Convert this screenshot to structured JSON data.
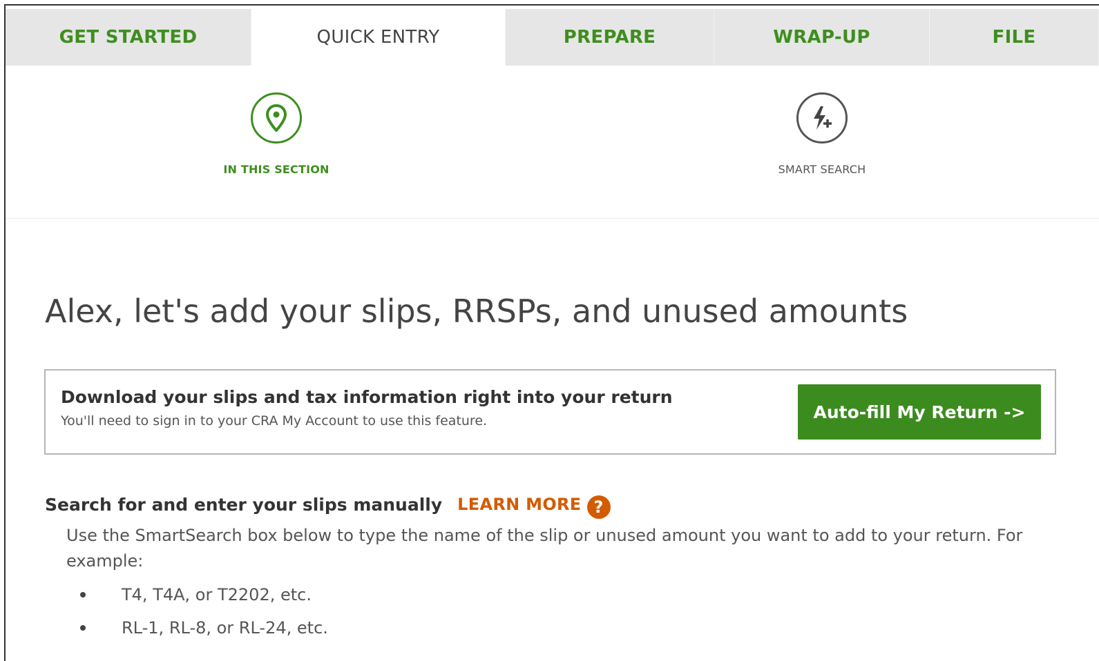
{
  "tabs": [
    {
      "label": "GET STARTED",
      "active": false
    },
    {
      "label": "QUICK ENTRY",
      "active": true
    },
    {
      "label": "PREPARE",
      "active": false
    },
    {
      "label": "WRAP-UP",
      "active": false
    },
    {
      "label": "FILE",
      "active": false
    }
  ],
  "tools": {
    "in_this_section": {
      "label": "IN THIS SECTION",
      "icon": "location-pin-icon",
      "color": "#3e8e1f"
    },
    "smart_search": {
      "label": "SMART SEARCH",
      "icon": "lightning-plus-icon",
      "color": "#555555"
    }
  },
  "main": {
    "headline": "Alex, let's add your slips, RRSPs, and unused amounts",
    "autofill": {
      "title": "Download your slips and tax information right into your return",
      "subtitle": "You'll need to sign in to your CRA My Account to use this feature.",
      "button_label": "Auto-fill My Return ->"
    },
    "manual": {
      "title": "Search for and enter your slips manually",
      "learn_more": "LEARN MORE",
      "help_icon_glyph": "?",
      "description": "Use the SmartSearch box below to type the name of the slip or unused amount you want to add to your return. For example:",
      "examples": [
        "T4, T4A, or T2202, etc.",
        "RL-1, RL-8, or RL-24, etc."
      ]
    }
  },
  "colors": {
    "brand_green": "#3e8e1f",
    "button_green": "#3c8b1f",
    "accent_orange": "#d35b00",
    "tab_inactive_bg": "#e6e6e6"
  }
}
